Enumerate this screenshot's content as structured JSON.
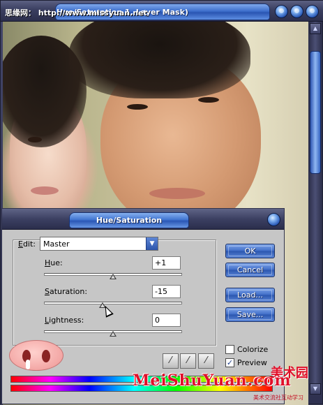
{
  "document": {
    "title": "Hue/Saturation 1, Layer Mask)",
    "watermark": "思缘网： http://www.missyuan.net"
  },
  "dialog": {
    "title": "Hue/Saturation",
    "edit_label": "Edit:",
    "edit_value": "Master",
    "hue_label": "Hue:",
    "hue_value": "+1",
    "saturation_label": "Saturation:",
    "saturation_value": "-15",
    "lightness_label": "Lightness:",
    "lightness_value": "0",
    "ok_label": "OK",
    "cancel_label": "Cancel",
    "load_label": "Load...",
    "save_label": "Save...",
    "colorize_label": "Colorize",
    "preview_label": "Preview",
    "colorize_checked": false,
    "preview_checked": true,
    "check_mark": "✓",
    "eyedropper_icons": [
      "eyedropper-icon",
      "eyedropper-plus-icon",
      "eyedropper-minus-icon"
    ]
  },
  "branding": {
    "logo_text": "MeiShuYuan.com",
    "logo_cn": "美术园",
    "tagline": "美术交流社互动学习"
  },
  "colors": {
    "accent_blue": "#3e6bc6",
    "dialog_bg": "#c6c6c6",
    "brand_red": "#e0102a"
  }
}
